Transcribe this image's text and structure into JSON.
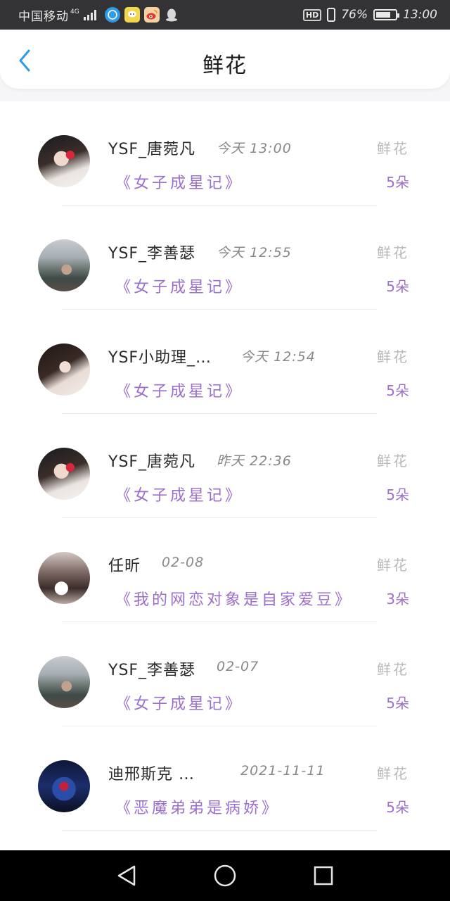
{
  "status_bar": {
    "carrier": "中国移动",
    "network": "4G",
    "hd": "HD",
    "battery": "76%",
    "battery_level": 0.76,
    "time": "13:00",
    "icons": [
      "signal-icon",
      "compass-app-icon",
      "chat-app-icon",
      "weibo-icon",
      "qq-icon",
      "vibrate-icon",
      "battery-icon"
    ]
  },
  "header": {
    "title": "鲜花",
    "back_icon": "chevron-left-icon",
    "accent_color": "#2f9be8"
  },
  "list": {
    "items": [
      {
        "name": "YSF_唐菀凡",
        "time": "今天 13:00",
        "type": "鲜花",
        "book": "《女子成星记》",
        "count": "5朵",
        "avatar": "avatar-tang"
      },
      {
        "name": "YSF_李善瑟",
        "time": "今天 12:55",
        "type": "鲜花",
        "book": "《女子成星记》",
        "count": "5朵",
        "avatar": "avatar-li"
      },
      {
        "name": "YSF小助理_…",
        "time": "今天 12:54",
        "type": "鲜花",
        "book": "《女子成星记》",
        "count": "5朵",
        "avatar": "avatar-xzl"
      },
      {
        "name": "YSF_唐菀凡",
        "time": "昨天 22:36",
        "type": "鲜花",
        "book": "《女子成星记》",
        "count": "5朵",
        "avatar": "avatar-tang"
      },
      {
        "name": "任昕",
        "time": "02-08",
        "type": "鲜花",
        "book": "《我的网恋对象是自家爱豆》",
        "count": "3朵",
        "avatar": "avatar-ren"
      },
      {
        "name": "YSF_李善瑟",
        "time": "02-07",
        "type": "鲜花",
        "book": "《女子成星记》",
        "count": "5朵",
        "avatar": "avatar-li"
      },
      {
        "name": "迪邢斯克 …",
        "time": "2021-11-11",
        "type": "鲜花",
        "book": "《恶魔弟弟是病娇》",
        "count": "5朵",
        "avatar": "avatar-di"
      }
    ],
    "book_color": "#9b6fcc"
  },
  "nav_bar": {
    "icons": [
      "back-triangle-icon",
      "home-circle-icon",
      "recents-square-icon"
    ]
  }
}
